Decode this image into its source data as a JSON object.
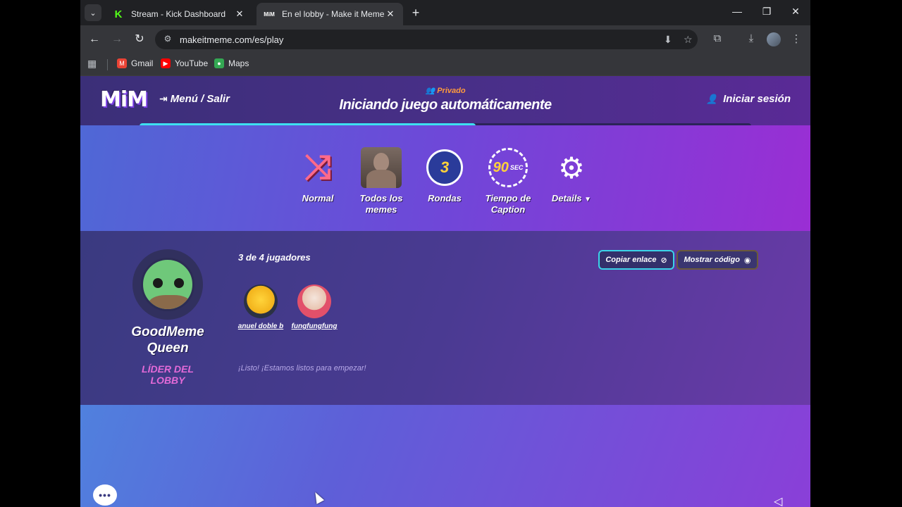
{
  "browser": {
    "tabs": [
      {
        "title": "Stream - Kick Dashboard",
        "icon": "kick-icon"
      },
      {
        "title": "En el lobby - Make it Meme",
        "icon": "mim-icon",
        "active": true
      }
    ],
    "url": "makeitmeme.com/es/play",
    "bookmarks": [
      {
        "label": "Gmail",
        "icon": "gmail-icon",
        "color": "#ea4335"
      },
      {
        "label": "YouTube",
        "icon": "youtube-icon",
        "color": "#ff0000"
      },
      {
        "label": "Maps",
        "icon": "maps-icon",
        "color": "#34a853"
      }
    ]
  },
  "site": {
    "logo": "MiM",
    "menu_label": "Menú / Salir",
    "privacy": "Privado",
    "title": "Iniciando juego automáticamente",
    "login_label": "Iniciar sesión",
    "progress": 0.55,
    "accent": "#3de0f0"
  },
  "settings": [
    {
      "label": "Normal",
      "icon": "shuffle-icon"
    },
    {
      "label": "Todos los memes",
      "icon": "memes-thumbnail-icon"
    },
    {
      "label": "Rondas",
      "icon": "rounds-icon",
      "value": "3"
    },
    {
      "label": "Tiempo de Caption",
      "icon": "timer-icon",
      "value": "90",
      "unit": "SEC"
    },
    {
      "label": "Details",
      "icon": "gear-icon"
    }
  ],
  "lobby": {
    "leader_name": "GoodMeme Queen",
    "leader_role": "LÍDER DEL LOBBY",
    "players_count": "3 de 4 jugadores",
    "players": [
      {
        "name": "anuel doble b"
      },
      {
        "name": "fungfungfung"
      }
    ],
    "status": "¡Listo! ¡Estamos listos para empezar!",
    "copy_link_label": "Copiar enlace",
    "show_code_label": "Mostrar código"
  }
}
